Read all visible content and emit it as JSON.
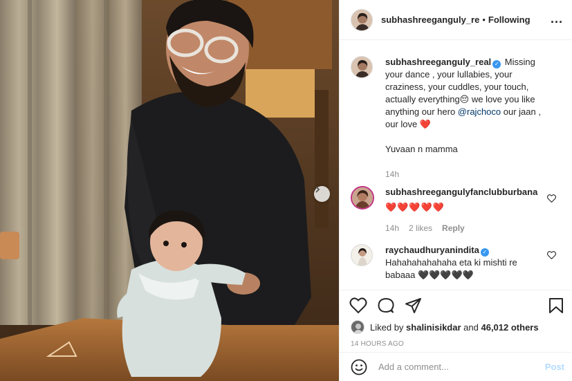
{
  "header": {
    "username": "subhashreeganguly_re",
    "separator": "•",
    "following": "Following",
    "more": "..."
  },
  "caption": {
    "username": "subhashreeganguly_real",
    "text_before_mention": "Missing your dance , your lullabies, your craziness, your cuddles, your touch, actually everything😔 we love you like anything our hero ",
    "mention": "@rajchoco",
    "text_after_mention": " our jaan , our love ",
    "heart": "❤️",
    "line2": "Yuvaan n mamma",
    "time": "14h"
  },
  "comments": [
    {
      "username": "subhashreegangulyfanclubburbana",
      "text": "❤️❤️❤️❤️❤️",
      "time": "14h",
      "likes": "2 likes",
      "reply": "Reply"
    },
    {
      "username": "raychaudhuryanindita",
      "text": "Hahahahahahaha eta ki mishti re babaaa 🖤🖤🖤🖤🖤"
    }
  ],
  "icons": [
    "heart-icon",
    "comment-icon",
    "share-icon",
    "bookmark-icon",
    "chevron-right-icon",
    "more-icon"
  ],
  "likes": {
    "prefix": "Liked by ",
    "user": "shalinisikdar",
    "middle": " and ",
    "count": "46,012 others"
  },
  "timestamp": "14 HOURS AGO",
  "add_comment": {
    "placeholder": "Add a comment...",
    "post": "Post"
  },
  "colors": {
    "link": "#00376b",
    "verified": "#3897f0",
    "post_disabled": "#b3dbff",
    "heart_red": "#ed4956"
  }
}
